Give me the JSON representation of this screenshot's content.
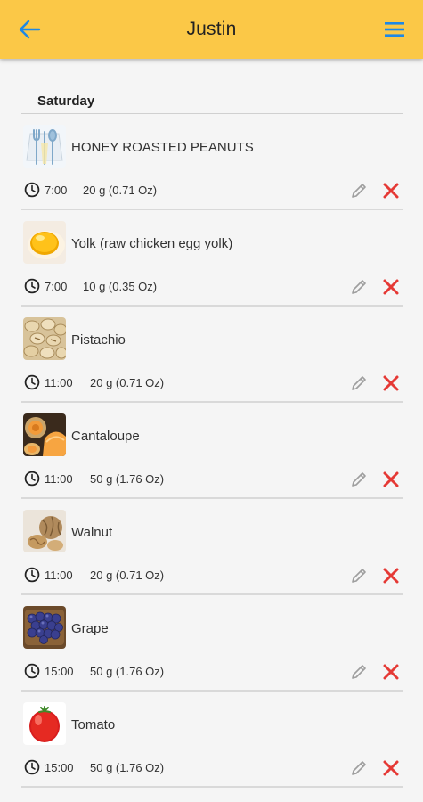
{
  "header": {
    "title": "Justin",
    "back_icon": "back-arrow-icon",
    "menu_icon": "hamburger-menu-icon",
    "background_color": "#fbc847",
    "icon_color": "#1e88e5"
  },
  "section": {
    "label": "Saturday"
  },
  "entries": [
    {
      "name": "HONEY ROASTED PEANUTS",
      "time": "7:00",
      "quantity": "20 g (0.71 Oz)",
      "image": "cutlery-placeholder-icon"
    },
    {
      "name": "Yolk (raw chicken egg yolk)",
      "time": "7:00",
      "quantity": "10 g (0.35 Oz)",
      "image": "egg-yolk-photo"
    },
    {
      "name": "Pistachio",
      "time": "11:00",
      "quantity": "20 g (0.71 Oz)",
      "image": "pistachio-photo"
    },
    {
      "name": "Cantaloupe",
      "time": "11:00",
      "quantity": "50 g (1.76 Oz)",
      "image": "cantaloupe-photo"
    },
    {
      "name": "Walnut",
      "time": "11:00",
      "quantity": "20 g (0.71 Oz)",
      "image": "walnut-photo"
    },
    {
      "name": "Grape",
      "time": "15:00",
      "quantity": "50 g (1.76 Oz)",
      "image": "grape-photo"
    },
    {
      "name": "Tomato",
      "time": "15:00",
      "quantity": "50 g (1.76 Oz)",
      "image": "tomato-photo"
    }
  ],
  "icons": {
    "time": "clock-icon",
    "edit": "pencil-icon",
    "delete": "close-x-icon"
  },
  "colors": {
    "delete": "#e53935",
    "edit": "#9e9e9e",
    "divider": "#d9d9d9"
  }
}
